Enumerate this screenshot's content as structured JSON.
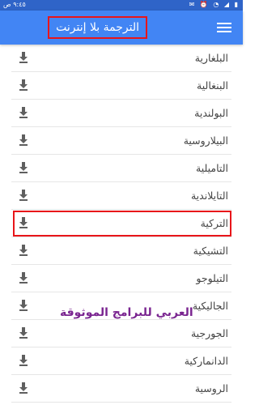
{
  "status_bar": {
    "time": "٩:٤٥ ص",
    "icons": [
      "email-icon",
      "alarm-icon",
      "wifi-icon",
      "signal-icon",
      "battery-icon"
    ]
  },
  "app_bar": {
    "title": "الترجمة بلا إنترنت",
    "menu_icon": "hamburger-menu-icon"
  },
  "languages": [
    {
      "name": "البلغارية",
      "highlighted": false
    },
    {
      "name": "البنغالية",
      "highlighted": false
    },
    {
      "name": "البولندية",
      "highlighted": false
    },
    {
      "name": "البيلاروسية",
      "highlighted": false
    },
    {
      "name": "التاميلية",
      "highlighted": false
    },
    {
      "name": "التايلاندية",
      "highlighted": false
    },
    {
      "name": "التركية",
      "highlighted": true
    },
    {
      "name": "التشيكية",
      "highlighted": false
    },
    {
      "name": "التيلوجو",
      "highlighted": false
    },
    {
      "name": "الجاليكية",
      "highlighted": false
    },
    {
      "name": "الجورجية",
      "highlighted": false
    },
    {
      "name": "الدانماركية",
      "highlighted": false
    },
    {
      "name": "الروسية",
      "highlighted": false
    }
  ],
  "watermark": "العربي للبرامج الموثوقة",
  "colors": {
    "app_bar": "#4285f4",
    "status_bar": "#2f64c8",
    "highlight": "#e8151a",
    "watermark": "#7a2590"
  }
}
